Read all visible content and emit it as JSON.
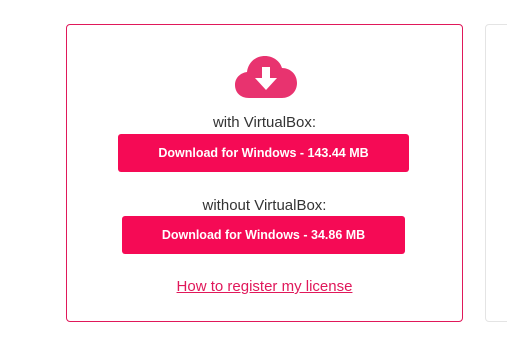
{
  "icon": "cloud-download-icon",
  "accent_color": "#f50a55",
  "with_vbox": {
    "label": "with VirtualBox:",
    "button_label": "Download for Windows - 143.44 MB"
  },
  "without_vbox": {
    "label": "without VirtualBox:",
    "button_label": "Download for Windows - 34.86 MB"
  },
  "register_link": "How to register my license"
}
